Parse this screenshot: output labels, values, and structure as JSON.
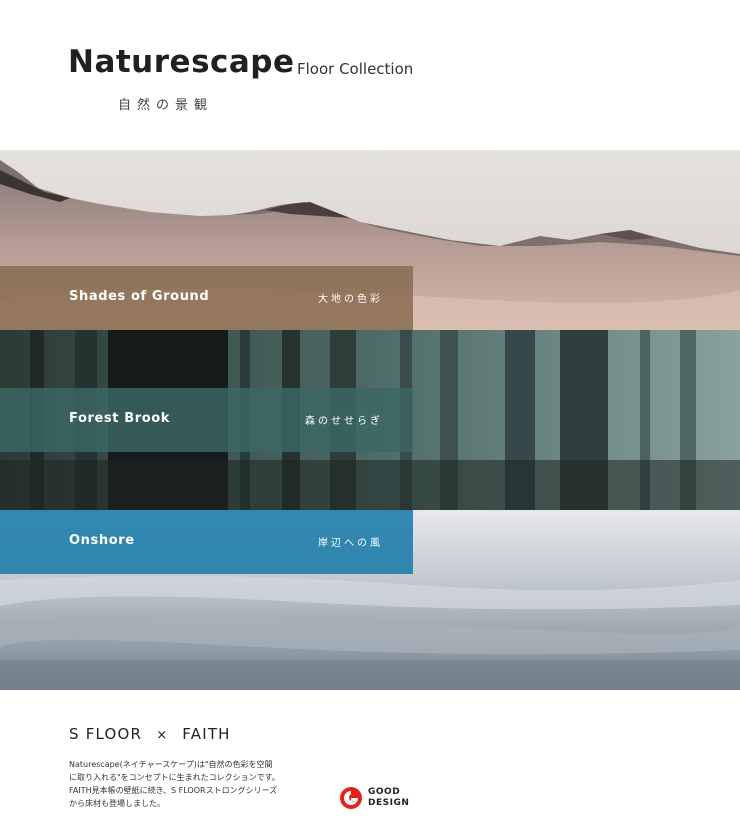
{
  "header": {
    "title": "Naturescape",
    "subtitle": "Floor Collection",
    "japanese": "自然の景観"
  },
  "sections": [
    {
      "title": "Shades of Ground",
      "japanese": "大地の色彩",
      "color": "#886c50"
    },
    {
      "title": "Forest Brook",
      "japanese": "森のせせらぎ",
      "color": "#3c6864"
    },
    {
      "title": "Onshore",
      "japanese": "岸辺への風",
      "color": "#2682ac"
    }
  ],
  "footer": {
    "brand_left": "S FLOOR",
    "separator": "×",
    "brand_right": "FAITH",
    "description": [
      "Naturescape(ネイチャースケープ)は\"自然の色彩を空間",
      "に取り入れる\"をコンセプトに生まれたコレクションです。",
      "FAITH見本帳の壁紙に続き、S FLOORストロングシリーズ",
      "から床材も登場しました。"
    ],
    "award": {
      "line1": "GOOD",
      "line2": "DESIGN",
      "color": "#e2231a"
    }
  }
}
